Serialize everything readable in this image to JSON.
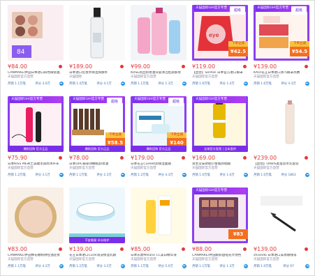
{
  "products": [
    {
      "id": "p1",
      "price": "¥84.00",
      "title": "CANMAKE/井田日本进口四色眼影盘",
      "subtitle": "天猫国际官方直营",
      "sales": "月销 1.1万笔",
      "rate": "评分 3.0万",
      "img": "eyeshadow"
    },
    {
      "id": "p2",
      "price": "¥189.00",
      "title": "日本进口化妆水保湿爽肤水",
      "subtitle": "天猫国际",
      "sales": "月销 1.4万笔",
      "rate": "评分 4.1万",
      "img": "bottle"
    },
    {
      "id": "p3",
      "price": "¥99.00",
      "title": "KOSE高丝卸妆油深层清洁脸部卸妆",
      "subtitle": "天猫国际官方直营",
      "sales": "月销 1.1万笔",
      "rate": "评分 1.3万",
      "img": "pink-bottle"
    },
    {
      "id": "p4",
      "price": "¥119.00",
      "title": "【直营】Sentan 日本官方进口眼罩",
      "subtitle": "天猫国际官方直营",
      "sales": "月销 1.6万笔",
      "rate": "评分 1.4万",
      "img": "sentan",
      "promo_label": "天猫国际GHI官方专营",
      "promo_tag": "超级",
      "promo_price": "¥42.5",
      "promo_side": "下单立减"
    },
    {
      "id": "p5",
      "price": "¥139.00",
      "title": "KAO/花王日本进口蒸汽眼罩热敷",
      "subtitle": "天猫国际官方直营",
      "sales": "月销 1.6万笔",
      "rate": "评分 4.3万",
      "img": "kao",
      "promo_label": "天猫国际GHI官方专营",
      "promo_tag": "超级",
      "promo_price": "¥54.5",
      "promo_side": "下单立减"
    },
    {
      "id": "p6",
      "price": "¥75.90",
      "title": "日本KISS ME奇士美睫毛膏防水纤长",
      "subtitle": "天猫国际官方直营",
      "sales": "月销 1.2万笔",
      "rate": "评分 3.1万",
      "img": "kissme",
      "promo_label": "天猫国际GHI官方专营",
      "promo_tag": "",
      "promo_price": "",
      "promo_side": "",
      "strip": "爆款回购 官方正品"
    },
    {
      "id": "p7",
      "price": "¥78.00",
      "title": "日本DHC蝶翠诗橄榄卸妆油",
      "subtitle": "天猫国际官方直营",
      "sales": "月销 1.1万笔",
      "rate": "评分 2.3万",
      "img": "dhc",
      "promo_label": "天猫国际GHI官方专营",
      "promo_tag": "超级",
      "promo_price": "¥58.5",
      "promo_side": "下单立减",
      "strip": "爆款回购 官方正品"
    },
    {
      "id": "p8",
      "price": "¥179.00",
      "title": "日本花王Curel珂润保湿面霜",
      "subtitle": "天猫国际官方直营",
      "sales": "月销 1.2万笔",
      "rate": "评分 4.3万",
      "img": "curel",
      "promo_label": "天猫国际GHI官方专营",
      "promo_tag": "超级",
      "promo_price": "¥140",
      "promo_side": "下单立减",
      "strip": "爆款回购 官方正品"
    },
    {
      "id": "p9",
      "price": "¥169.00",
      "title": "资生堂安耐晒小金瓶防晒霜",
      "subtitle": "天猫国际官方直营",
      "sales": "月销 1.0万笔",
      "rate": "评分 1.6万",
      "img": "anessa",
      "promo_label": "天猫国际GHI官方专营",
      "promo_tag": "",
      "promo_price": "",
      "promo_side": "",
      "strip": "全球官方直营 | 日本直供"
    },
    {
      "id": "p10",
      "price": "¥239.00",
      "title": "【直营】ORBIS奥蜜思水乳套装",
      "subtitle": "天猫国际官方直营",
      "sales": "月销 1.0万笔",
      "rate": "评分 1863",
      "img": "orbis"
    },
    {
      "id": "p11",
      "price": "¥83.00",
      "title": "CANMAKE/井田棉花糖粉饼控油定妆",
      "subtitle": "天猫国际官方直营",
      "sales": "月销 1.1万笔",
      "rate": "评分 4.2万",
      "img": "compact"
    },
    {
      "id": "p12",
      "price": "¥139.00",
      "title": "花王日本进口Curel润浸保湿乳霜",
      "subtitle": "天猫国际官方直营",
      "sales": "月销 1.2万笔",
      "rate": "评分 3.2万",
      "img": "cream",
      "strip": "干皮救星 补水修护"
    },
    {
      "id": "p13",
      "price": "¥85.00",
      "title": "日本乐敦Melano CC美白精华液",
      "subtitle": "天猫国际官方直营",
      "sales": "月销 1.1万笔",
      "rate": "评分 5.0万",
      "img": "melano"
    },
    {
      "id": "p14",
      "price": "¥88.00",
      "title": "CANMAKE/井田眼影盘哑光大地色",
      "subtitle": "天猫国际官方直营",
      "sales": "月销 1.1万笔",
      "rate": "评分 1.3万",
      "img": "palette",
      "promo_label": "天猫国际GHI官方专营",
      "promo_tag": "",
      "promo_price": "¥83",
      "promo_side": "",
      "strip": ""
    },
    {
      "id": "p15",
      "price": "¥139.00",
      "title": "shiseido 日本进口美妆眼线笔",
      "subtitle": "天猫国际官方直营",
      "sales": "月销 1.0万笔",
      "rate": "评分 97",
      "img": "brush"
    }
  ]
}
